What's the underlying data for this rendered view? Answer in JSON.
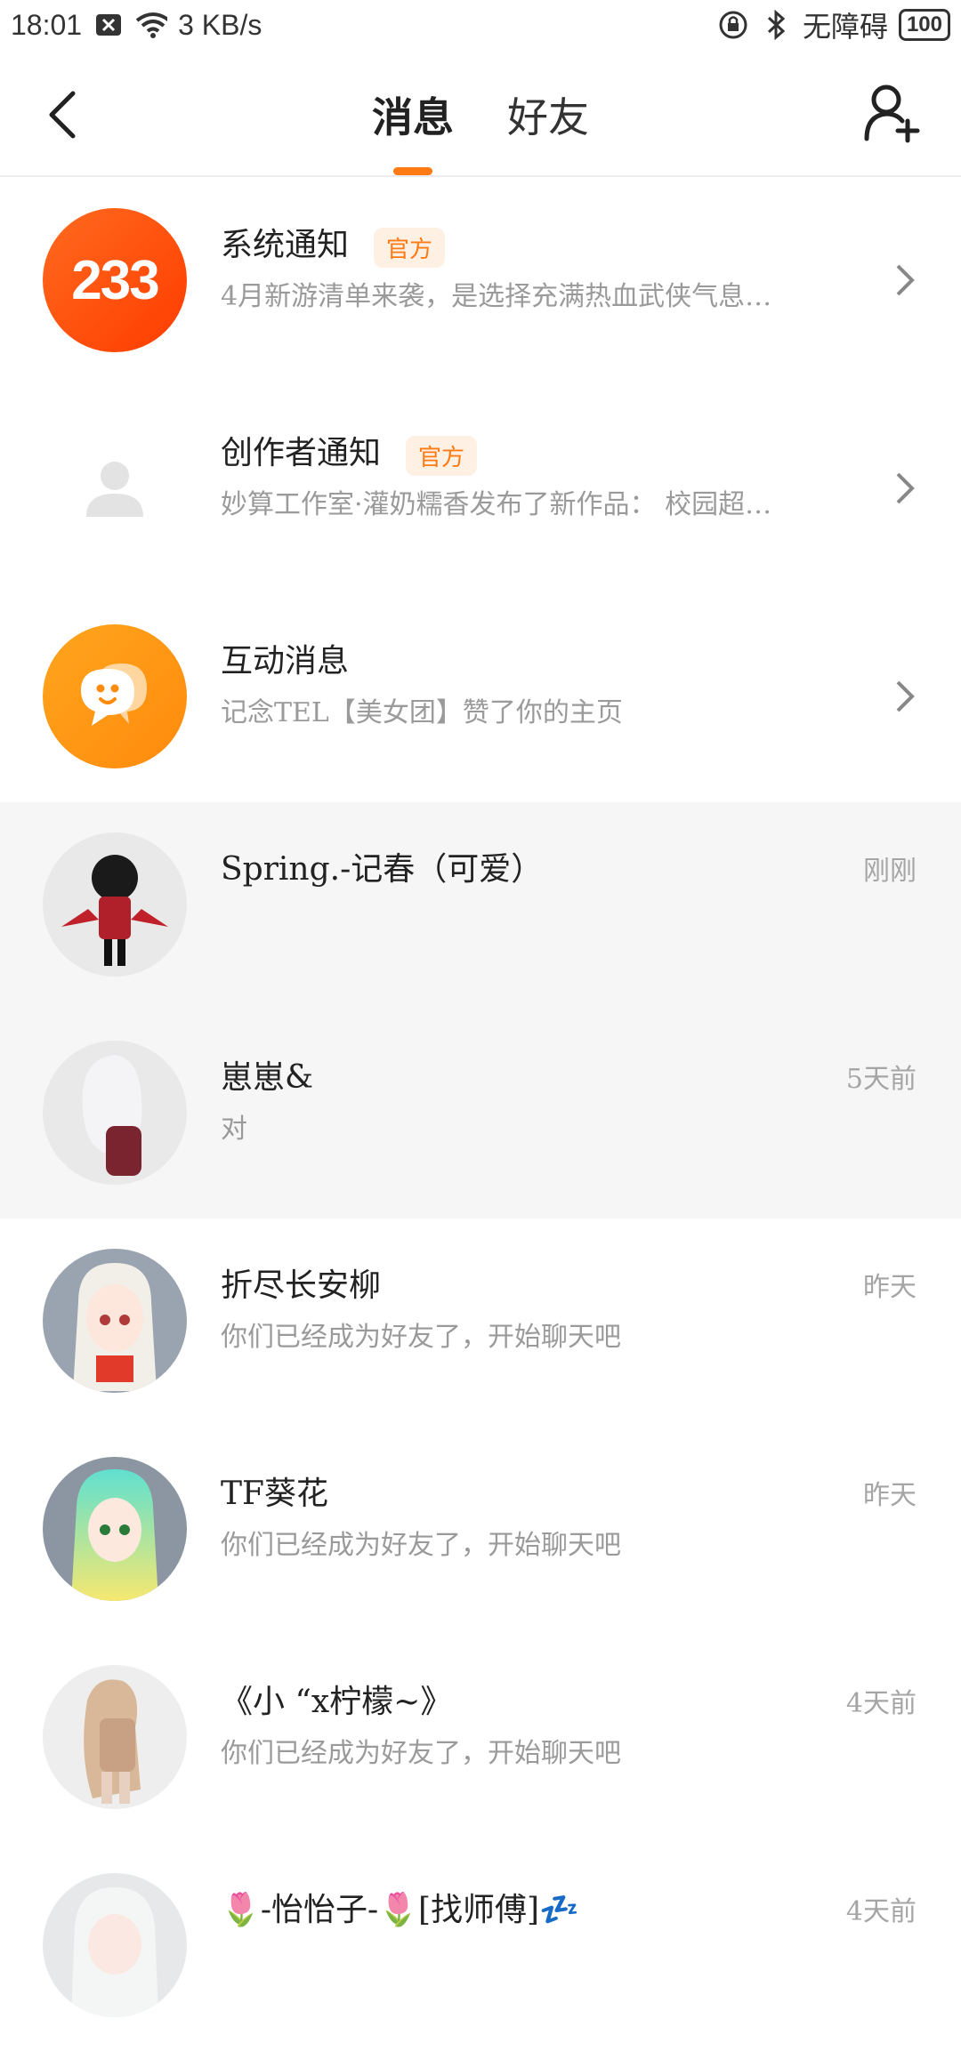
{
  "status_bar": {
    "time": "18:01",
    "net_speed": "3 KB/s",
    "accessibility": "无障碍",
    "battery": "100"
  },
  "header": {
    "tabs": [
      "消息",
      "好友"
    ],
    "active_tab": "消息",
    "accent_color": "#ff7a12"
  },
  "rows": [
    {
      "name": "系统通知",
      "badge": "官方",
      "preview": "4月新游清单来袭，是选择充满热血武侠气息…",
      "time": "",
      "has_chevron": true
    },
    {
      "name": "创作者通知",
      "badge": "官方",
      "preview": "妙算工作室·灌奶糯香发布了新作品： 校园超…",
      "time": "",
      "has_chevron": true
    },
    {
      "name": "互动消息",
      "badge": "",
      "preview": "记念TEL【美女团】赞了你的主页",
      "time": "",
      "has_chevron": true
    },
    {
      "name": "Spring.-记春（可爱）",
      "badge": "",
      "preview": "",
      "time": "刚刚",
      "has_chevron": false
    },
    {
      "name": "崽崽&",
      "badge": "",
      "preview": "对",
      "time": "5天前",
      "has_chevron": false
    },
    {
      "name": "折尽长安柳",
      "badge": "",
      "preview": "你们已经成为好友了，开始聊天吧",
      "time": "昨天",
      "has_chevron": false
    },
    {
      "name": "TF葵花",
      "badge": "",
      "preview": "你们已经成为好友了，开始聊天吧",
      "time": "昨天",
      "has_chevron": false
    },
    {
      "name": "《小 “x柠檬~》",
      "badge": "",
      "preview": "你们已经成为好友了，开始聊天吧",
      "time": "4天前",
      "has_chevron": false
    },
    {
      "name": "🌷-怡怡子-🌷[找师傅]💤",
      "badge": "",
      "preview": "",
      "time": "4天前",
      "has_chevron": false
    }
  ],
  "avatar_labels": {
    "system": "233"
  }
}
